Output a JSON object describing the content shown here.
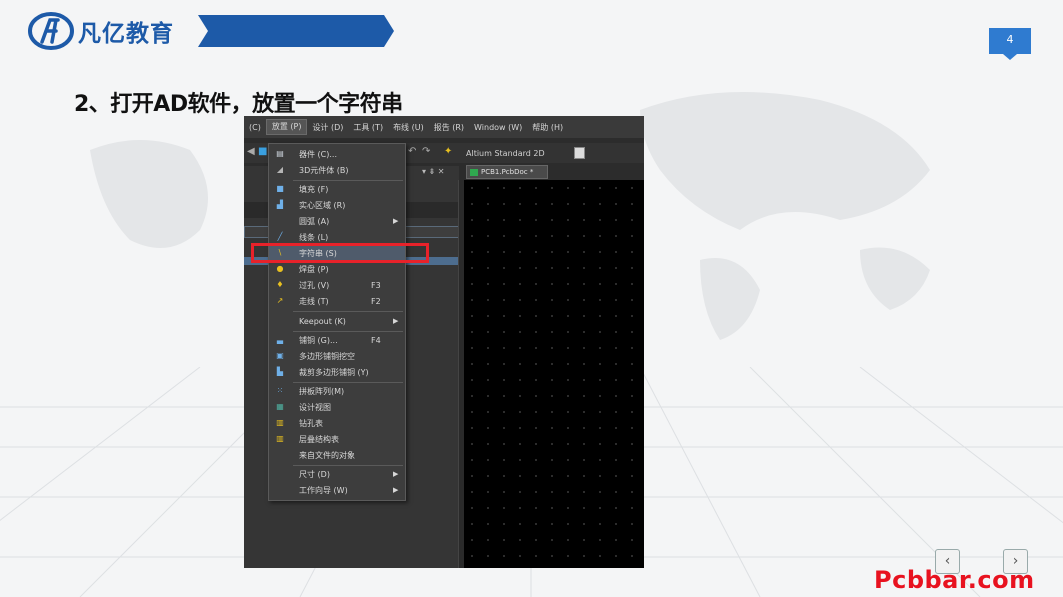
{
  "brand": {
    "name": "凡亿教育"
  },
  "page": {
    "number": "4"
  },
  "heading": "2、打开AD软件，放置一个字符串",
  "app": {
    "menubar": [
      "(C)",
      "放置 (P)",
      "设计 (D)",
      "工具 (T)",
      "布线 (U)",
      "报告 (R)",
      "Window (W)",
      "帮助 (H)"
    ],
    "toolbar_view": "Altium Standard 2D",
    "doc_tab": "PCB1.PcbDoc *",
    "place_menu": [
      {
        "label": "器件 (C)...",
        "shortcut": "",
        "submenu": false
      },
      {
        "label": "3D元件体 (B)",
        "shortcut": "",
        "submenu": false
      },
      {
        "label": "填充 (F)",
        "shortcut": "",
        "submenu": false
      },
      {
        "label": "实心区域 (R)",
        "shortcut": "",
        "submenu": false
      },
      {
        "label": "圆弧 (A)",
        "shortcut": "",
        "submenu": true
      },
      {
        "label": "线条 (L)",
        "shortcut": "",
        "submenu": false
      },
      {
        "label": "字符串 (S)",
        "shortcut": "",
        "submenu": false
      },
      {
        "label": "焊盘 (P)",
        "shortcut": "",
        "submenu": false
      },
      {
        "label": "过孔 (V)",
        "shortcut": "F3",
        "submenu": false
      },
      {
        "label": "走线 (T)",
        "shortcut": "F2",
        "submenu": false
      },
      {
        "label": "Keepout (K)",
        "shortcut": "",
        "submenu": true
      },
      {
        "label": "铺铜 (G)...",
        "shortcut": "F4",
        "submenu": false
      },
      {
        "label": "多边形铺铜挖空",
        "shortcut": "",
        "submenu": false
      },
      {
        "label": "裁剪多边形铺铜 (Y)",
        "shortcut": "",
        "submenu": false
      },
      {
        "label": "拼板阵列(M)",
        "shortcut": "",
        "submenu": false
      },
      {
        "label": "设计视图",
        "shortcut": "",
        "submenu": false
      },
      {
        "label": "钻孔表",
        "shortcut": "",
        "submenu": false
      },
      {
        "label": "层叠结构表",
        "shortcut": "",
        "submenu": false
      },
      {
        "label": "来自文件的对象",
        "shortcut": "",
        "submenu": false
      },
      {
        "label": "尺寸 (D)",
        "shortcut": "",
        "submenu": true
      },
      {
        "label": "工作向导 (W)",
        "shortcut": "",
        "submenu": true
      }
    ]
  },
  "nav": {
    "prev": "‹",
    "next": "›"
  },
  "watermark": "Pcbbar.com",
  "colors": {
    "accent": "#2f7bd0",
    "brand": "#1d5aa8",
    "highlight": "#e8222a",
    "watermark": "#e8121f"
  }
}
